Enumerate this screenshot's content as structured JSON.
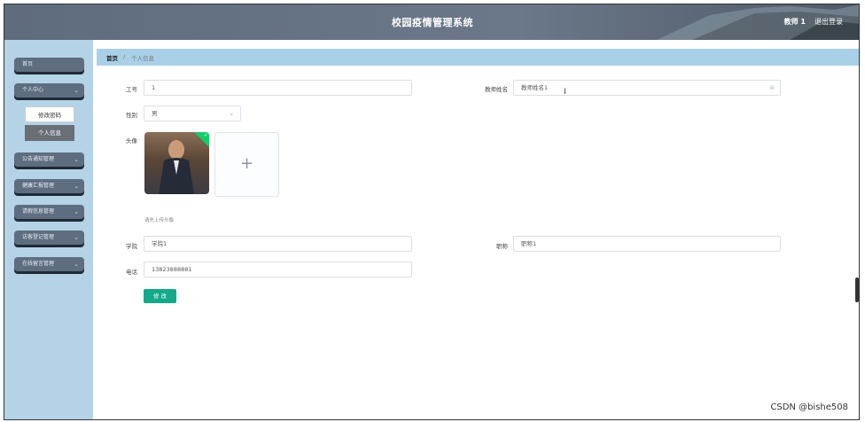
{
  "header": {
    "title": "校园疫情管理系统",
    "user": "教师 1",
    "logout": "退出登录"
  },
  "sidebar": {
    "items": [
      {
        "label": "首页"
      },
      {
        "label": "个人中心"
      },
      {
        "label": "公告通知管理"
      },
      {
        "label": "健康汇报管理"
      },
      {
        "label": "请假信息管理"
      },
      {
        "label": "访客登记管理"
      },
      {
        "label": "在线留言管理"
      }
    ],
    "submenu": [
      {
        "label": "修改密码"
      },
      {
        "label": "个人信息"
      }
    ]
  },
  "breadcrumb": {
    "home": "首页",
    "separator": "/",
    "current": "个人信息"
  },
  "form": {
    "gonghao": {
      "label": "工号",
      "value": "1"
    },
    "name": {
      "label": "教师姓名",
      "value": "教师姓名1"
    },
    "gender": {
      "label": "性别",
      "value": "男"
    },
    "avatar": {
      "label": "头像",
      "hint": "请先上传头像"
    },
    "college": {
      "label": "学院",
      "value": "学院1"
    },
    "title": {
      "label": "职称",
      "value": "职称1"
    },
    "phone": {
      "label": "电话",
      "value": "13823888881"
    },
    "submit": "修 改"
  },
  "watermark": "CSDN @bishe508",
  "colors": {
    "header_bg": "#66758a",
    "sidebar_bg": "#b5d3e7",
    "breadcrumb_bg": "#a9d0e7",
    "submit_bg": "#13a98a",
    "upload_ok": "#13ce66"
  }
}
